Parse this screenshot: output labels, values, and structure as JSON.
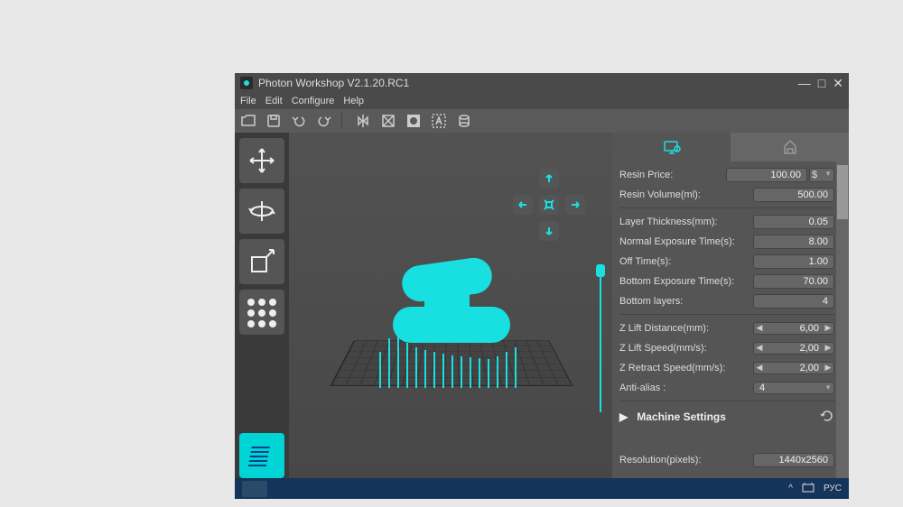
{
  "app": {
    "title": "Photon Workshop V2.1.20.RC1"
  },
  "menu": {
    "file": "File",
    "edit": "Edit",
    "configure": "Configure",
    "help": "Help"
  },
  "params": {
    "resin_price": {
      "label": "Resin Price:",
      "value": "100.00",
      "currency": "$"
    },
    "resin_volume": {
      "label": "Resin Volume(ml):",
      "value": "500.00"
    },
    "layer_thickness": {
      "label": "Layer Thickness(mm):",
      "value": "0.05"
    },
    "normal_exposure": {
      "label": "Normal Exposure Time(s):",
      "value": "8.00"
    },
    "off_time": {
      "label": "Off Time(s):",
      "value": "1.00"
    },
    "bottom_exposure": {
      "label": "Bottom Exposure Time(s):",
      "value": "70.00"
    },
    "bottom_layers": {
      "label": "Bottom layers:",
      "value": "4"
    },
    "z_lift_dist": {
      "label": "Z Lift Distance(mm):",
      "value": "6,00"
    },
    "z_lift_speed": {
      "label": "Z Lift Speed(mm/s):",
      "value": "2,00"
    },
    "z_retract_speed": {
      "label": "Z Retract Speed(mm/s):",
      "value": "2,00"
    },
    "anti_alias": {
      "label": "Anti-alias :",
      "value": "4"
    }
  },
  "sections": {
    "machine_settings": "Machine Settings"
  },
  "machine": {
    "resolution": {
      "label": "Resolution(pixels):",
      "value": "1440x2560"
    }
  },
  "taskbar": {
    "lang": "РУС"
  }
}
